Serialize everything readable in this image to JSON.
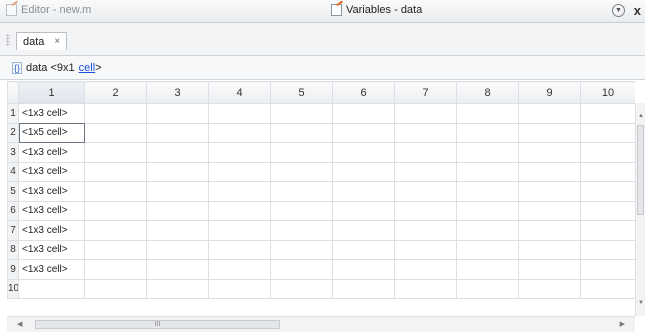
{
  "titlebar": {
    "editor_title": "Editor - new.m",
    "variables_title": "Variables - data",
    "menu_icon": "chevron-circle-icon",
    "close_icon": "close-icon",
    "close_glyph": "x"
  },
  "doc_tab": {
    "label": "data",
    "close_glyph": "×"
  },
  "info": {
    "icon_glyph": "{}",
    "prefix": "data <9x1 ",
    "type_link": "cell",
    "suffix": ">"
  },
  "grid": {
    "columns": [
      "1",
      "2",
      "3",
      "4",
      "5",
      "6",
      "7",
      "8",
      "9",
      "10"
    ],
    "rows": [
      {
        "num": "1",
        "value": "<1x3 cell>"
      },
      {
        "num": "2",
        "value": "<1x5 cell>"
      },
      {
        "num": "3",
        "value": "<1x3 cell>"
      },
      {
        "num": "4",
        "value": "<1x3 cell>"
      },
      {
        "num": "5",
        "value": "<1x3 cell>"
      },
      {
        "num": "6",
        "value": "<1x3 cell>"
      },
      {
        "num": "7",
        "value": "<1x3 cell>"
      },
      {
        "num": "8",
        "value": "<1x3 cell>"
      },
      {
        "num": "9",
        "value": "<1x3 cell>"
      },
      {
        "num": "10",
        "value": ""
      }
    ],
    "selected_row": 2,
    "selected_column": "1"
  },
  "scrollbar": {
    "hthumb_glyph": "III",
    "vthumb_glyph": "≡"
  },
  "colors": {
    "link": "#1a4fd6",
    "accent_icon": "#d86a2a",
    "cell_border": "#dcdfe3"
  }
}
